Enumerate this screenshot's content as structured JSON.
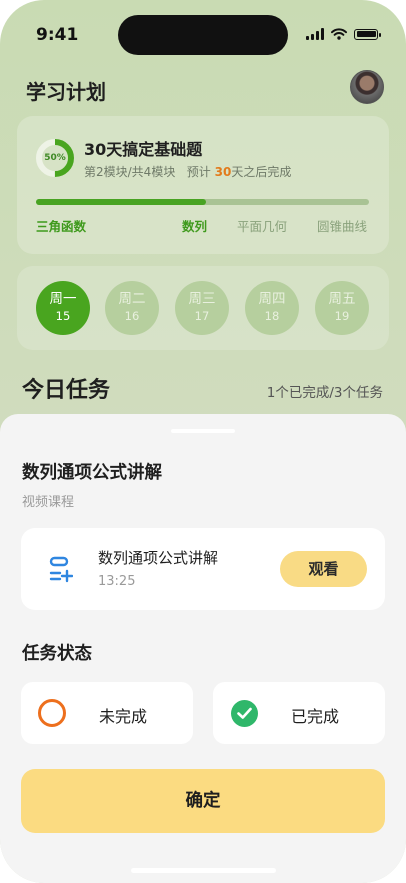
{
  "status_bar": {
    "time": "9:41"
  },
  "header": {
    "title": "学习计划"
  },
  "plan": {
    "title": "30天搞定基础题",
    "progress_label": "50%",
    "progress_fraction": 0.5,
    "module_text": "第2模块/共4模块",
    "estimate_prefix": "预计",
    "estimate_days": "30",
    "estimate_suffix": "天之后完成",
    "bar_fraction": 0.51,
    "topics": [
      "三角函数",
      "数列",
      "平面几何",
      "圆锥曲线"
    ],
    "active_topics": [
      "三角函数",
      "数列"
    ]
  },
  "week": {
    "days": [
      {
        "name": "周一",
        "date": "15",
        "active": true
      },
      {
        "name": "周二",
        "date": "16",
        "active": false
      },
      {
        "name": "周三",
        "date": "17",
        "active": false
      },
      {
        "name": "周四",
        "date": "18",
        "active": false
      },
      {
        "name": "周五",
        "date": "19",
        "active": false
      }
    ]
  },
  "today": {
    "title": "今日任务",
    "count_text": "1个已完成/3个任务"
  },
  "sheet": {
    "title": "数列通项公式讲解",
    "subtitle": "视频课程",
    "lesson": {
      "name": "数列通项公式讲解",
      "duration": "13:25",
      "action_label": "观看",
      "icon": "list-add-icon"
    },
    "status_title": "任务状态",
    "options": [
      {
        "label": "未完成",
        "icon": "circle-outline-icon",
        "color": "#ED6F1D"
      },
      {
        "label": "已完成",
        "icon": "check-circle-icon",
        "color": "#2FB76A"
      }
    ],
    "confirm_label": "确定"
  },
  "colors": {
    "accent_green": "#49A51F",
    "accent_yellow": "#FBDB81",
    "highlight_orange": "#E27B1C"
  }
}
